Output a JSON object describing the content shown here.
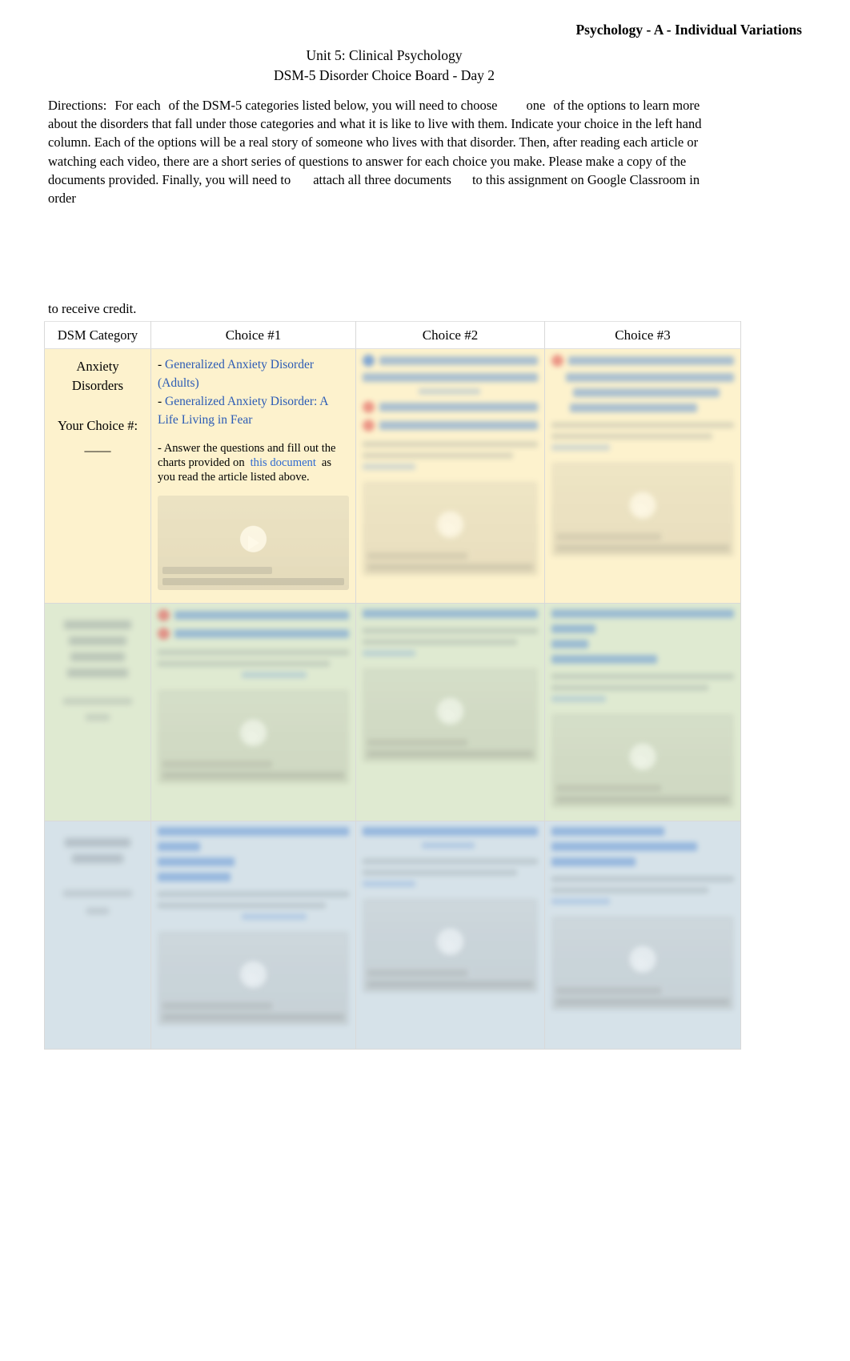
{
  "header": {
    "course": "Psychology - A - Individual Variations",
    "unit": "Unit 5: Clinical Psychology",
    "subtitle": "DSM-5 Disorder Choice Board - Day 2"
  },
  "directions": {
    "label": "Directions:",
    "seg1": "For each",
    "seg2": "of the DSM-5 categories listed below, you will need to choose",
    "seg3": "one",
    "seg4": "of the options to learn more about the disorders that fall under those categories and what it is like to live with them. Indicate your choice in the left hand column. Each of the options will be a real story of someone who lives with that disorder. Then, after reading each article or watching each video, there are a short series of questions to answer for each choice you make. Please make a copy of the documents provided. Finally, you will need to",
    "seg5": "attach all three documents",
    "seg6": "to this assignment on Google Classroom in order",
    "tail": "to receive credit."
  },
  "table": {
    "headers": {
      "category": "DSM Category",
      "choice1": "Choice #1",
      "choice2": "Choice #2",
      "choice3": "Choice #3"
    },
    "rows": [
      {
        "id": "anxiety",
        "category_line1": "Anxiety",
        "category_line2": "Disorders",
        "your_choice_label": "Your Choice #:",
        "your_choice_value": "——",
        "tint": "#fdf2cd",
        "choice1": {
          "link1_prefix": "- ",
          "link1": "Generalized Anxiety Disorder (Adults)",
          "link2_prefix": "- ",
          "link2": "Generalized Anxiety Disorder: A Life Living in Fear",
          "instruction_before": "- Answer the questions and fill out the charts provided on",
          "instruction_link": "this document",
          "instruction_after": "as you read the article listed above."
        },
        "choice2": {
          "obscured": true
        },
        "choice3": {
          "obscured": true
        }
      },
      {
        "id": "trauma",
        "category_line1": "",
        "category_line2": "",
        "your_choice_label": "",
        "your_choice_value": "",
        "tint": "#dfead1",
        "choice1": {
          "obscured": true
        },
        "choice2": {
          "obscured": true
        },
        "choice3": {
          "obscured": true
        }
      },
      {
        "id": "depressive",
        "category_line1": "",
        "category_line2": "",
        "your_choice_label": "",
        "your_choice_value": "",
        "tint": "#d6e2e9",
        "choice1": {
          "obscured": true
        },
        "choice2": {
          "obscured": true
        },
        "choice3": {
          "obscured": true
        }
      }
    ]
  }
}
